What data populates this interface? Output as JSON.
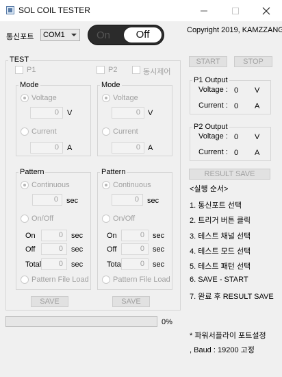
{
  "window": {
    "title": "SOL COIL TESTER",
    "minimize_icon": "minimize-icon",
    "maximize_icon": "maximize-icon",
    "close_icon": "close-icon"
  },
  "connection": {
    "port_label": "통신포트",
    "port_selected": "COM1",
    "toggle_on_label": "On",
    "toggle_off_label": "Off",
    "toggle_state": "Off"
  },
  "copyright": "Copyright 2019, KAMZZANG",
  "test": {
    "group_label": "TEST",
    "p1_label": "P1",
    "p2_label": "P2",
    "simultaneous_label": "동시제어",
    "channels": [
      {
        "mode_label": "Mode",
        "voltage_label": "Voltage",
        "voltage_value": "0",
        "voltage_unit": "V",
        "current_label": "Current",
        "current_value": "0",
        "current_unit": "A",
        "pattern_label": "Pattern",
        "continuous_label": "Continuous",
        "continuous_value": "0",
        "continuous_unit": "sec",
        "onoff_label": "On/Off",
        "on_label": "On",
        "on_value": "0",
        "off_label": "Off",
        "off_value": "0",
        "total_label": "Total",
        "total_value": "0",
        "sec_unit": "sec",
        "file_load_label": "Pattern File Load",
        "save_label": "SAVE"
      },
      {
        "mode_label": "Mode",
        "voltage_label": "Voltage",
        "voltage_value": "0",
        "voltage_unit": "V",
        "current_label": "Current",
        "current_value": "0",
        "current_unit": "A",
        "pattern_label": "Pattern",
        "continuous_label": "Continuous",
        "continuous_value": "0",
        "continuous_unit": "sec",
        "onoff_label": "On/Off",
        "on_label": "On",
        "on_value": "0",
        "off_label": "Off",
        "off_value": "0",
        "total_label": "Tota",
        "total_value": "0",
        "sec_unit": "sec",
        "file_load_label": "Pattern File Load",
        "save_label": "SAVE"
      }
    ]
  },
  "controls": {
    "start_label": "START",
    "stop_label": "STOP",
    "result_save_label": "RESULT SAVE"
  },
  "outputs": [
    {
      "label": "P1 Output",
      "voltage_label": "Voltage :",
      "voltage_value": "0",
      "voltage_unit": "V",
      "current_label": "Current :",
      "current_value": "0",
      "current_unit": "A"
    },
    {
      "label": "P2 Output",
      "voltage_label": "Voltage :",
      "voltage_value": "0",
      "voltage_unit": "V",
      "current_label": "Current :",
      "current_value": "0",
      "current_unit": "A"
    }
  ],
  "progress": {
    "percent_text": "0%",
    "fraction": 0
  },
  "instructions": {
    "title": "<실행 순서>",
    "steps": [
      "1. 통신포트 선택",
      "2. 트리거 버튼 클릭",
      "3. 테스트 채널 선택",
      "4. 테스트 모드 선택",
      "5. 테스트 패턴 선택",
      "6. SAVE - START",
      "7. 완료 후 RESULT SAVE"
    ],
    "note1": "* 파워서플라이 포트설정",
    "note2": ", Baud : 19200 고정"
  }
}
